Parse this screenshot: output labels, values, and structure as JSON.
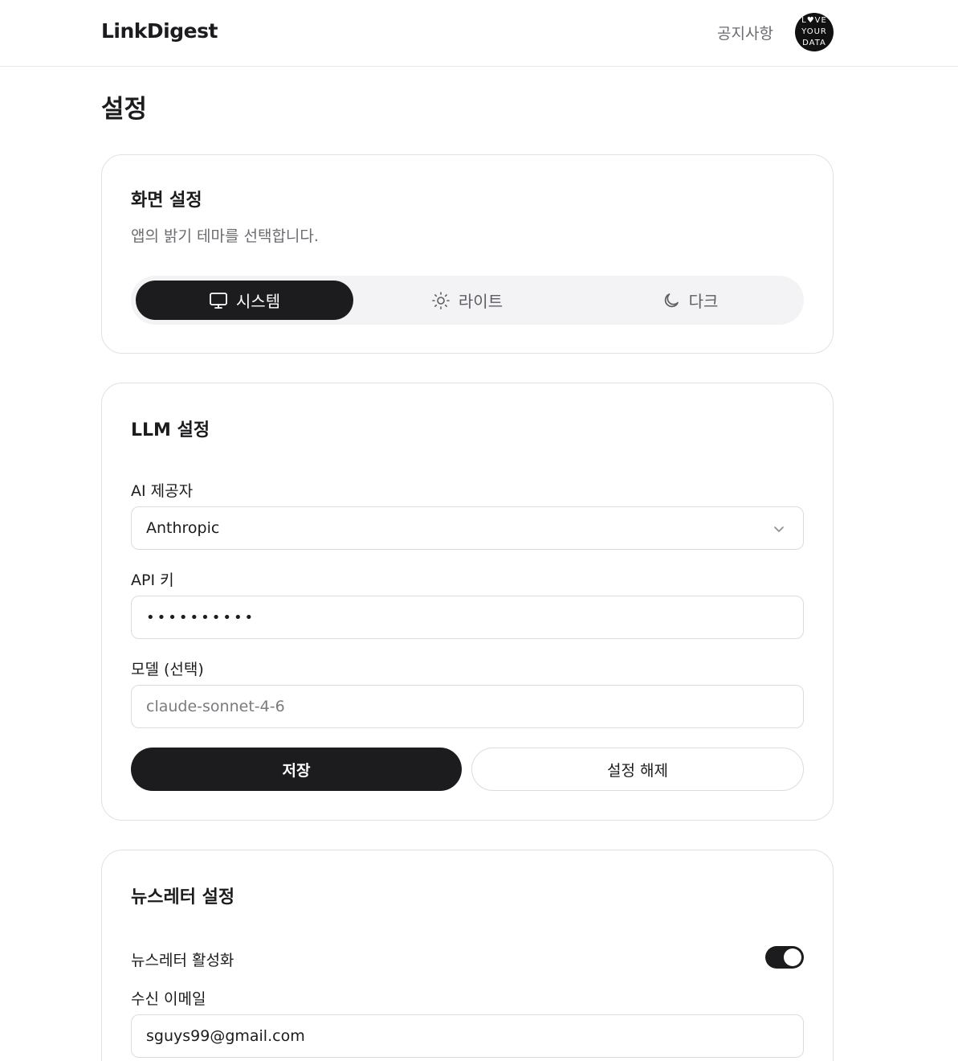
{
  "header": {
    "logo": "LinkDigest",
    "notice": "공지사항",
    "avatar_lines": [
      "L♥VE",
      "YOUR",
      "DATA"
    ]
  },
  "page": {
    "title": "설정"
  },
  "display": {
    "title": "화면 설정",
    "description": "앱의 밝기 테마를 선택합니다.",
    "themes": [
      {
        "label": "시스템",
        "icon": "monitor-icon",
        "active": true
      },
      {
        "label": "라이트",
        "icon": "sun-icon",
        "active": false
      },
      {
        "label": "다크",
        "icon": "moon-icon",
        "active": false
      }
    ]
  },
  "llm": {
    "title": "LLM 설정",
    "provider_label": "AI 제공자",
    "provider_value": "Anthropic",
    "api_key_label": "API 키",
    "api_key_value": "••••••••••",
    "model_label": "모델 (선택)",
    "model_placeholder": "claude-sonnet-4-6",
    "save_label": "저장",
    "reset_label": "설정 해제"
  },
  "newsletter": {
    "title": "뉴스레터 설정",
    "enable_label": "뉴스레터 활성화",
    "enabled": true,
    "email_label": "수신 이메일",
    "email_value": "sguys99@gmail.com"
  },
  "colors": {
    "primary": "#1c1c1e",
    "muted_text": "#6b6b70",
    "border": "#e1e1e4",
    "segment_bg": "#f3f3f5"
  }
}
